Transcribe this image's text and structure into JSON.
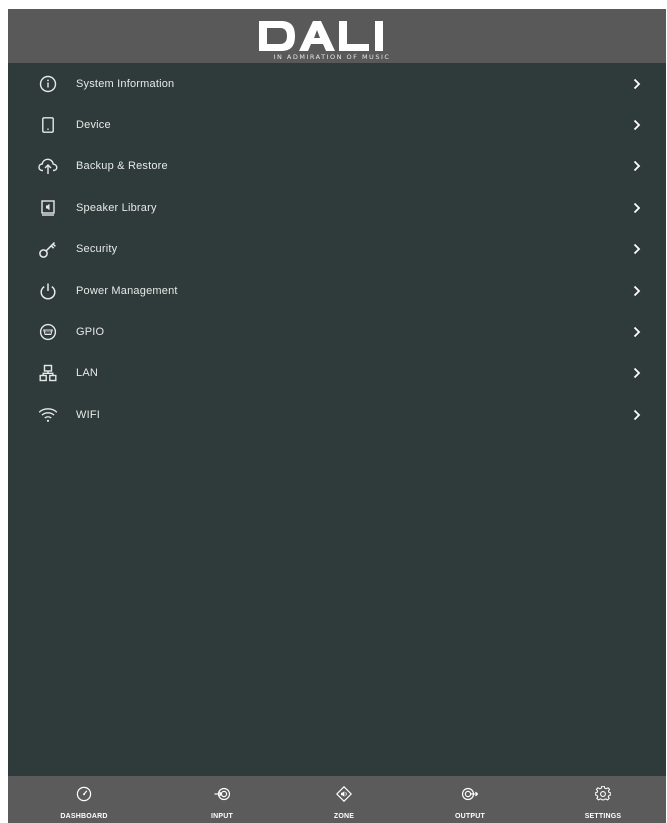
{
  "header": {
    "logo_text": "DALI",
    "tagline": "IN ADMIRATION OF MUSIC"
  },
  "colors": {
    "panel_background": "#2f3b3a",
    "header_background": "#595959",
    "footer_background": "#5b5b5b",
    "text": "#e6e9e8"
  },
  "menu": {
    "items": [
      {
        "label": "System Information",
        "icon": "info-icon"
      },
      {
        "label": "Device",
        "icon": "device-icon"
      },
      {
        "label": "Backup & Restore",
        "icon": "cloud-upload-icon"
      },
      {
        "label": "Speaker Library",
        "icon": "speaker-library-icon"
      },
      {
        "label": "Security",
        "icon": "key-icon"
      },
      {
        "label": "Power Management",
        "icon": "power-icon"
      },
      {
        "label": "GPIO",
        "icon": "gpio-connector-icon"
      },
      {
        "label": "LAN",
        "icon": "network-icon"
      },
      {
        "label": "WIFI",
        "icon": "wifi-icon"
      }
    ]
  },
  "footer": {
    "nav": [
      {
        "label": "DASHBOARD",
        "icon": "gauge-icon"
      },
      {
        "label": "INPUT",
        "icon": "input-icon"
      },
      {
        "label": "ZONE",
        "icon": "zone-speaker-icon"
      },
      {
        "label": "OUTPUT",
        "icon": "output-icon"
      },
      {
        "label": "SETTINGS",
        "icon": "gear-icon"
      }
    ]
  }
}
